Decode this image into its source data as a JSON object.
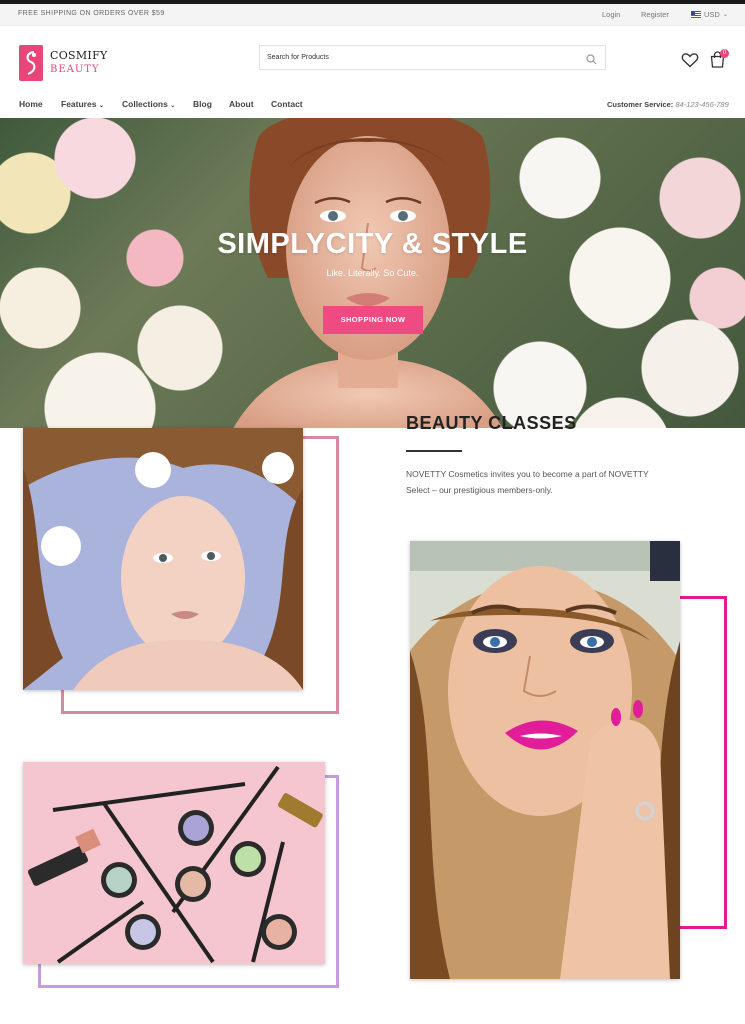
{
  "topbar": {
    "shipping": "FREE SHIPPING ON ORDERS OVER $59",
    "login": "Login",
    "register": "Register",
    "currency": "USD"
  },
  "brand": {
    "name_line1": "COSMIFY",
    "name_line2": "BEAUTY",
    "accent_color": "#e8457b"
  },
  "search": {
    "placeholder": "Search for Products"
  },
  "header_icons": {
    "wishlist": "heart-icon",
    "cart": "shopping-bag-icon",
    "cart_count": "0"
  },
  "nav": {
    "items": [
      {
        "label": "Home"
      },
      {
        "label": "Features"
      },
      {
        "label": "Collections"
      },
      {
        "label": "Blog"
      },
      {
        "label": "About"
      },
      {
        "label": "Contact"
      }
    ],
    "service_label": "Customer Service:",
    "service_phone": "84-123-456-789"
  },
  "hero": {
    "title": "SIMPLYCITY & STYLE",
    "subtitle": "Like. Literally. So Cute.",
    "button": "SHOPPING NOW",
    "button_color": "#ef4b82"
  },
  "beauty": {
    "title": "BEAUTY CLASSES",
    "text": "NOVETTY Cosmetics invites you to become a part of NOVETTY Select – our prestigious members-only."
  },
  "frames": {
    "frame1_color": "#d68aa2",
    "frame2_color": "#c79be0",
    "frame3_color": "#e01c8c"
  }
}
